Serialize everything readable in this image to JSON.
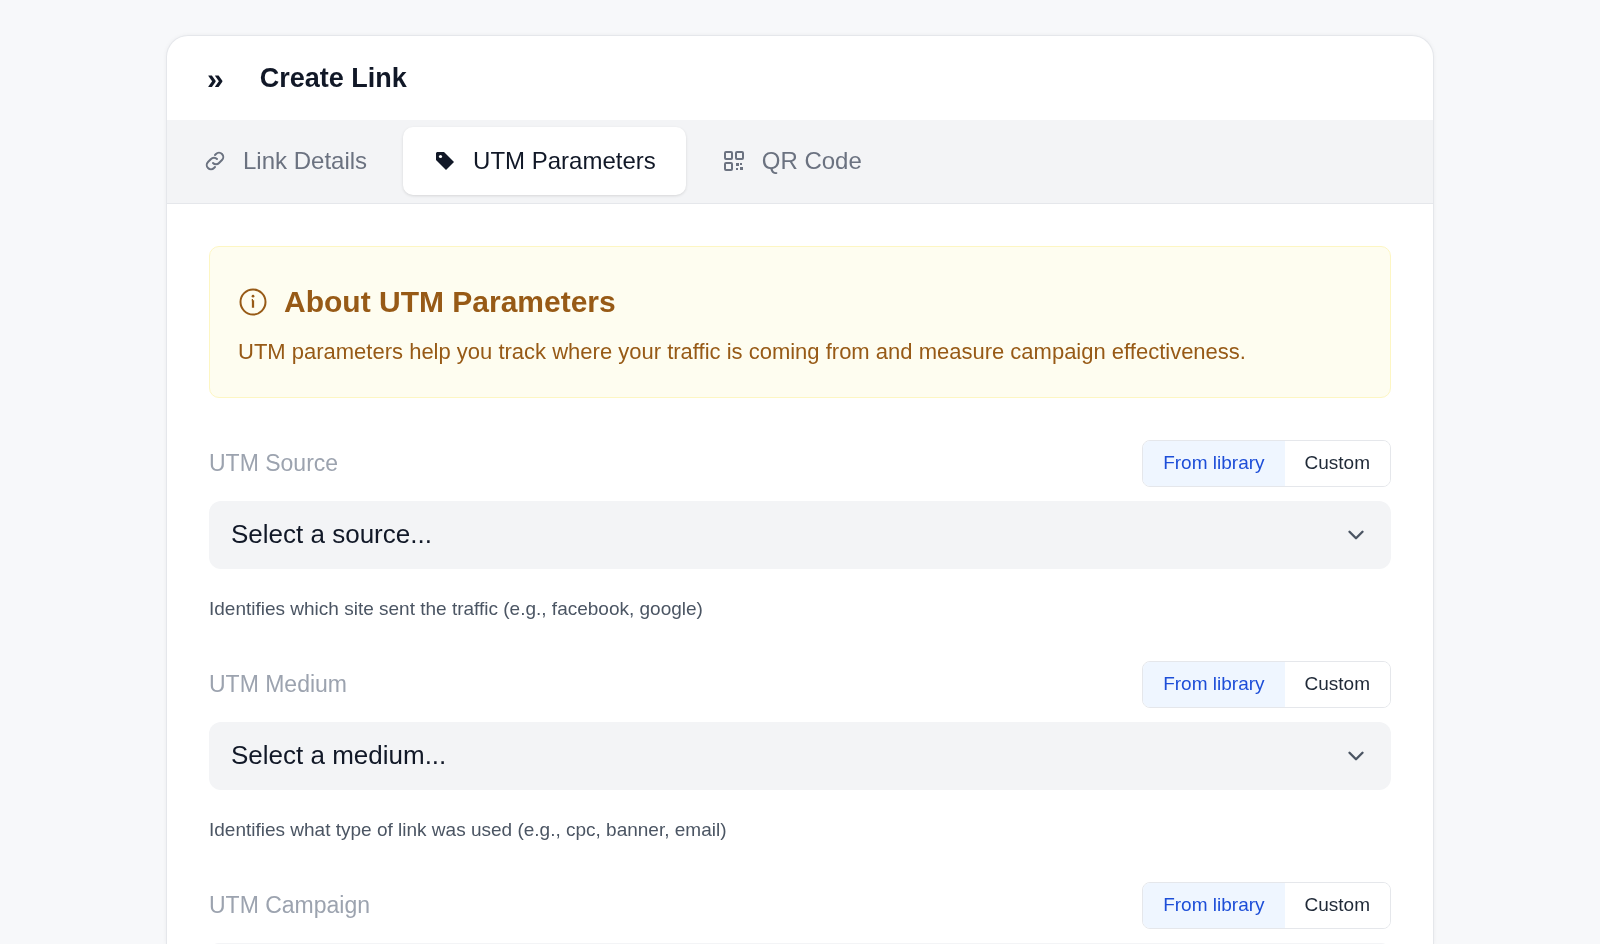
{
  "header": {
    "icon": "»",
    "title": "Create Link"
  },
  "tabs": [
    {
      "label": "Link Details",
      "kind": "link",
      "selected": false
    },
    {
      "label": "UTM Parameters",
      "kind": "tag",
      "selected": true
    },
    {
      "label": "QR Code",
      "kind": "qr",
      "selected": false
    }
  ],
  "notice": {
    "title": "About UTM Parameters",
    "text": "UTM parameters help you track where your traffic is coming from and measure campaign effectiveness."
  },
  "fields": [
    {
      "label": "UTM Source",
      "modes": [
        {
          "label": "From library",
          "selected": true
        },
        {
          "label": "Custom",
          "selected": false
        }
      ],
      "placeholder": "Select a source...",
      "help": "Identifies which site sent the traffic (e.g., facebook, google)"
    },
    {
      "label": "UTM Medium",
      "modes": [
        {
          "label": "From library",
          "selected": true
        },
        {
          "label": "Custom",
          "selected": false
        }
      ],
      "placeholder": "Select a medium...",
      "help": "Identifies what type of link was used (e.g., cpc, banner, email)"
    },
    {
      "label": "UTM Campaign",
      "modes": [
        {
          "label": "From library",
          "selected": true
        },
        {
          "label": "Custom",
          "selected": false
        }
      ]
    }
  ]
}
